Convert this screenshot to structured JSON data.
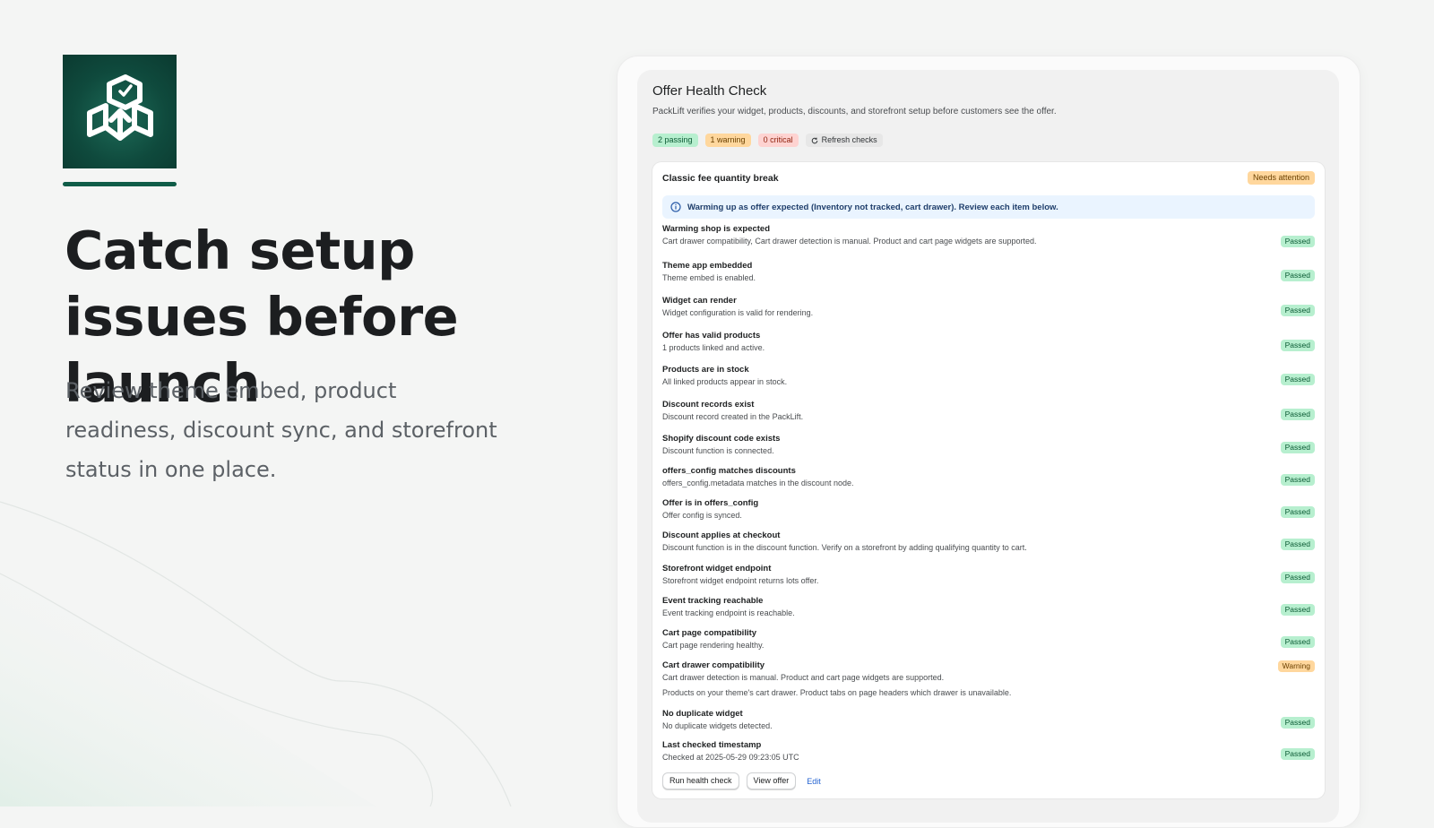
{
  "hero": {
    "title": "Catch setup issues before launch",
    "subtitle": "Review theme embed, product readiness, discount sync, and storefront status in one place."
  },
  "panel": {
    "title": "Offer Health Check",
    "description": "PackLift verifies your widget, products, discounts, and storefront setup before customers see the offer.",
    "summary": {
      "passing": "2 passing",
      "warning": "1 warning",
      "critical": "0 critical",
      "refresh": "Refresh checks"
    }
  },
  "card": {
    "title": "Classic fee quantity break",
    "status_badge": "Needs attention",
    "banner": "Warming up as offer expected (Inventory not tracked, cart drawer). Review each item below.",
    "checks": [
      {
        "title": "Warming shop is expected",
        "desc": "Cart drawer compatibility, Cart drawer detection is manual. Product and cart page widgets are supported.",
        "status": "Passed"
      },
      {
        "title": "Theme app embedded",
        "desc": "Theme embed is enabled.",
        "status": "Passed"
      },
      {
        "title": "Widget can render",
        "desc": "Widget configuration is valid for rendering.",
        "status": "Passed"
      },
      {
        "title": "Offer has valid products",
        "desc": "1 products linked and active.",
        "status": "Passed"
      },
      {
        "title": "Products are in stock",
        "desc": "All linked products appear in stock.",
        "status": "Passed"
      },
      {
        "title": "Discount records exist",
        "desc": "Discount record created in the PackLift.",
        "status": "Passed"
      },
      {
        "title": "Shopify discount code exists",
        "desc": "Discount function is connected.",
        "status": "Passed"
      },
      {
        "title": "offers_config matches discounts",
        "desc": "offers_config.metadata matches in the discount node.",
        "status": "Passed"
      },
      {
        "title": "Offer is in offers_config",
        "desc": "Offer config is synced.",
        "status": "Passed"
      },
      {
        "title": "Discount applies at checkout",
        "desc": "Discount function is in the discount function. Verify on a storefront by adding qualifying quantity to cart.",
        "status": "Passed"
      },
      {
        "title": "Storefront widget endpoint",
        "desc": "Storefront widget endpoint returns lots offer.",
        "status": "Passed"
      },
      {
        "title": "Event tracking reachable",
        "desc": "Event tracking endpoint is reachable.",
        "status": "Passed"
      },
      {
        "title": "Cart page compatibility",
        "desc": "Cart page rendering healthy.",
        "status": "Passed"
      },
      {
        "title": "Cart drawer compatibility",
        "desc": "Cart drawer detection is manual. Product and cart page widgets are supported.",
        "extra": "Products on your theme's cart drawer. Product tabs on page headers which drawer is unavailable.",
        "status": "Warning"
      },
      {
        "title": "No duplicate widget",
        "desc": "No duplicate widgets detected.",
        "status": "Passed"
      },
      {
        "title": "Last checked timestamp",
        "desc": "Checked at 2025-05-29 09:23:05 UTC",
        "status": "Passed"
      }
    ],
    "actions": {
      "run": "Run health check",
      "view": "View offer",
      "edit": "Edit"
    }
  },
  "colors": {
    "brand": "#0f5c47",
    "passed_bg": "#b7efcf",
    "warning_bg": "#ffd79d",
    "critical_bg": "#fed3d1",
    "info_bg": "#eaf4ff",
    "link": "#2463d1"
  },
  "icons": [
    "packlift-logo-icon",
    "info-icon",
    "refresh-icon"
  ]
}
